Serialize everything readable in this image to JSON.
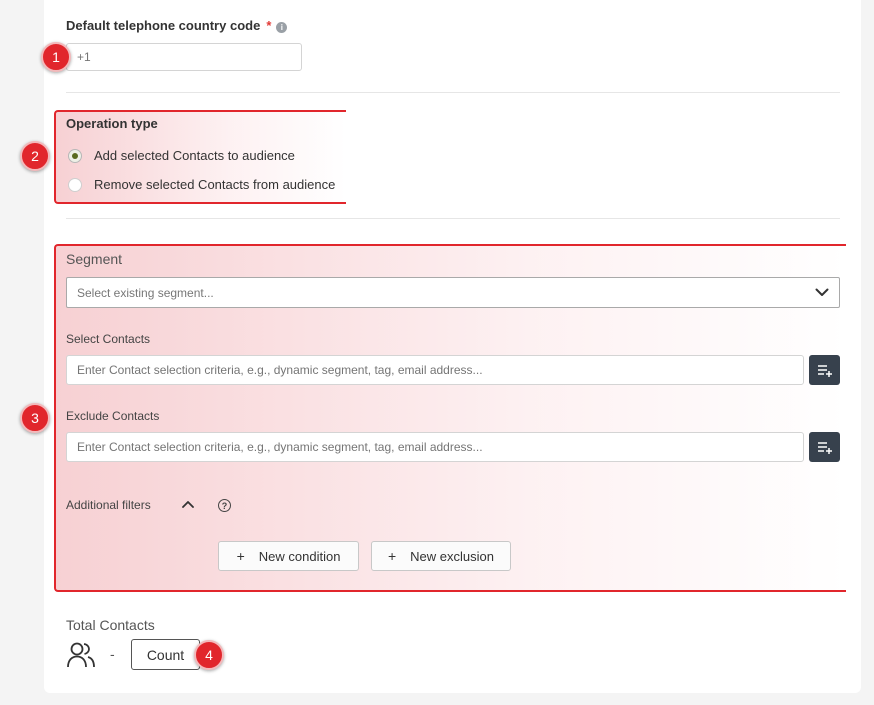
{
  "country_code": {
    "label": "Default telephone country code",
    "required_mark": "*",
    "info_glyph": "i",
    "placeholder": "+1"
  },
  "operation_type": {
    "label": "Operation type",
    "options": [
      {
        "label": "Add selected Contacts to audience",
        "checked": true
      },
      {
        "label": "Remove selected Contacts from audience",
        "checked": false
      }
    ]
  },
  "segment": {
    "label": "Segment",
    "placeholder": "Select existing segment..."
  },
  "select_contacts": {
    "label": "Select Contacts",
    "placeholder": "Enter Contact selection criteria, e.g., dynamic segment, tag, email address..."
  },
  "exclude_contacts": {
    "label": "Exclude Contacts",
    "placeholder": "Enter Contact selection criteria, e.g., dynamic segment, tag, email address..."
  },
  "additional_filters": {
    "label": "Additional filters",
    "help_glyph": "?",
    "new_condition": "New condition",
    "new_exclusion": "New exclusion",
    "plus": "+"
  },
  "total_contacts": {
    "label": "Total Contacts",
    "value": "-",
    "count_button": "Count"
  },
  "badges": [
    "1",
    "2",
    "3",
    "4"
  ],
  "colors": {
    "highlight": "#e1262c",
    "dark_button": "#37414d",
    "radio_selected": "#5a6b1e"
  },
  "icons": {
    "people": "people-icon",
    "chevron": "chevron-down-icon",
    "add_list": "list-add-icon",
    "collapse": "chevron-up-icon"
  }
}
